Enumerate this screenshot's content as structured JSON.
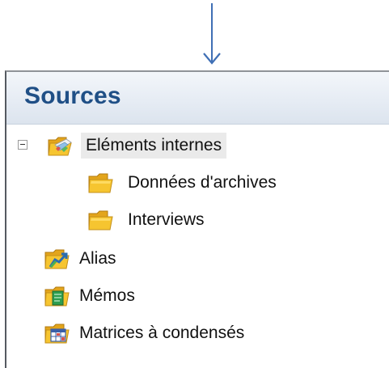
{
  "panel": {
    "title": "Sources"
  },
  "tree": {
    "items": [
      {
        "label": "Eléments internes",
        "icon": "internal-sources-folder-icon",
        "expanded": true,
        "selected": true
      },
      {
        "label": "Données d'archives",
        "icon": "folder-icon"
      },
      {
        "label": "Interviews",
        "icon": "folder-icon"
      },
      {
        "label": "Alias",
        "icon": "alias-folder-icon"
      },
      {
        "label": "Mémos",
        "icon": "memos-folder-icon"
      },
      {
        "label": "Matrices à condensés",
        "icon": "framework-matrices-folder-icon"
      }
    ]
  },
  "colors": {
    "title": "#1f4f86",
    "header_bg": "#e6ecf4",
    "selection": "#eaeaea",
    "arrow": "#3f6fb5",
    "folder": "#f6c530"
  }
}
